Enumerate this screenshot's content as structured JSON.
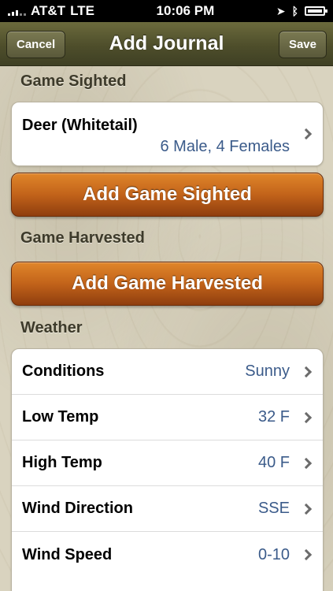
{
  "status_bar": {
    "carrier": "AT&T",
    "network": "LTE",
    "time": "10:06 PM"
  },
  "nav": {
    "title": "Add Journal",
    "cancel_label": "Cancel",
    "save_label": "Save"
  },
  "sections": {
    "game_sighted": "Game Sighted",
    "game_harvested": "Game Harvested",
    "weather": "Weather"
  },
  "sighted_item": {
    "name": "Deer (Whitetail)",
    "detail": "6 Male, 4 Females"
  },
  "buttons": {
    "add_sighted": "Add Game Sighted",
    "add_harvested": "Add Game Harvested"
  },
  "weather_rows": [
    {
      "label": "Conditions",
      "value": "Sunny"
    },
    {
      "label": "Low Temp",
      "value": "32 F"
    },
    {
      "label": "High Temp",
      "value": "40 F"
    },
    {
      "label": "Wind Direction",
      "value": "SSE"
    },
    {
      "label": "Wind Speed",
      "value": "0-10"
    }
  ],
  "colors": {
    "accent_orange": "#c2631a",
    "nav_olive": "#4e4e2b",
    "value_blue": "#3b5b8a"
  }
}
